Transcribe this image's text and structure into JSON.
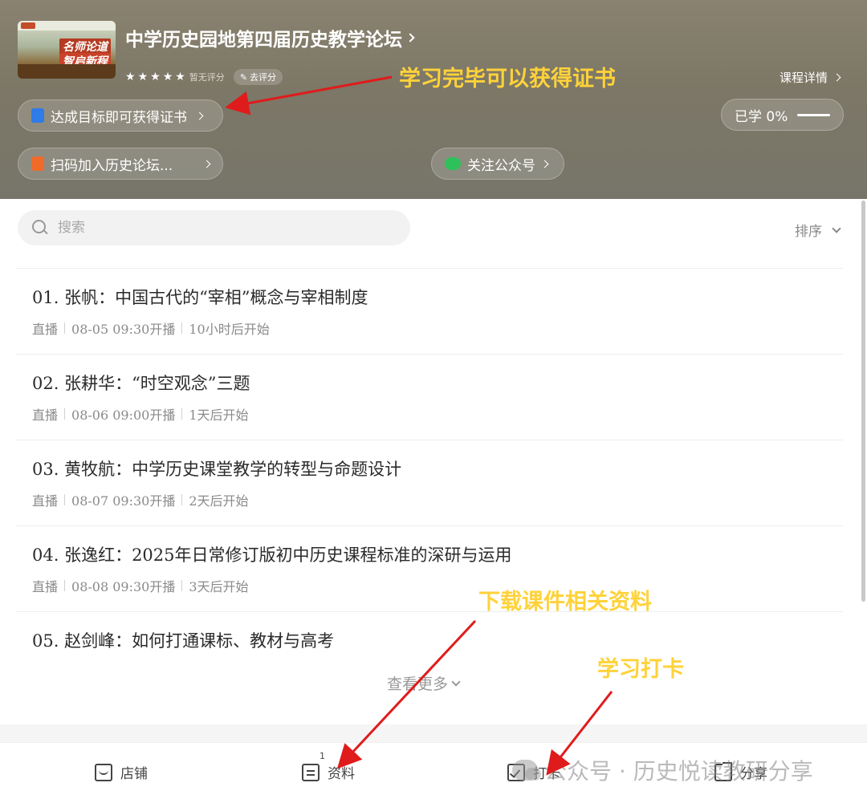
{
  "header": {
    "course_title": "中学历史园地第四届历史教学论坛",
    "cover_text_1": "名师论道",
    "cover_text_2": "智启新程",
    "rating_text": "暂无评分",
    "rate_button": "去评分",
    "detail_link": "课程详情",
    "cert_pill": "达成目标即可获得证书",
    "progress_pill": "已学 0%",
    "progress_value": 0,
    "group_pill": "扫码加入历史论坛...",
    "follow_pill": "关注公众号"
  },
  "annotations": {
    "certificate": "学习完毕可以获得证书",
    "download": "下载课件相关资料",
    "checkin": "学习打卡",
    "arrow_color": "#e01b1b",
    "text_color": "#ffd23a"
  },
  "search": {
    "placeholder": "搜索",
    "sort_label": "排序"
  },
  "lessons": [
    {
      "title": "01. 张帆：中国古代的“宰相”概念与宰相制度",
      "type": "直播",
      "time": "08-05 09:30开播",
      "countdown": "10小时后开始"
    },
    {
      "title": "02. 张耕华：“时空观念”三题",
      "type": "直播",
      "time": "08-06 09:00开播",
      "countdown": "1天后开始"
    },
    {
      "title": "03. 黄牧航：中学历史课堂教学的转型与命题设计",
      "type": "直播",
      "time": "08-07 09:30开播",
      "countdown": "2天后开始"
    },
    {
      "title": "04. 张逸红：2025年日常修订版初中历史课程标准的深研与运用",
      "type": "直播",
      "time": "08-08 09:30开播",
      "countdown": "3天后开始"
    },
    {
      "title": "05. 赵剑峰：如何打通课标、教材与高考"
    }
  ],
  "more_label": "查看更多",
  "bottom_nav": {
    "shop": "店铺",
    "materials": "资料",
    "materials_badge": "1",
    "checkin": "打卡",
    "share": "分享"
  },
  "watermark": "公众号 · 历史悦读教研分享"
}
